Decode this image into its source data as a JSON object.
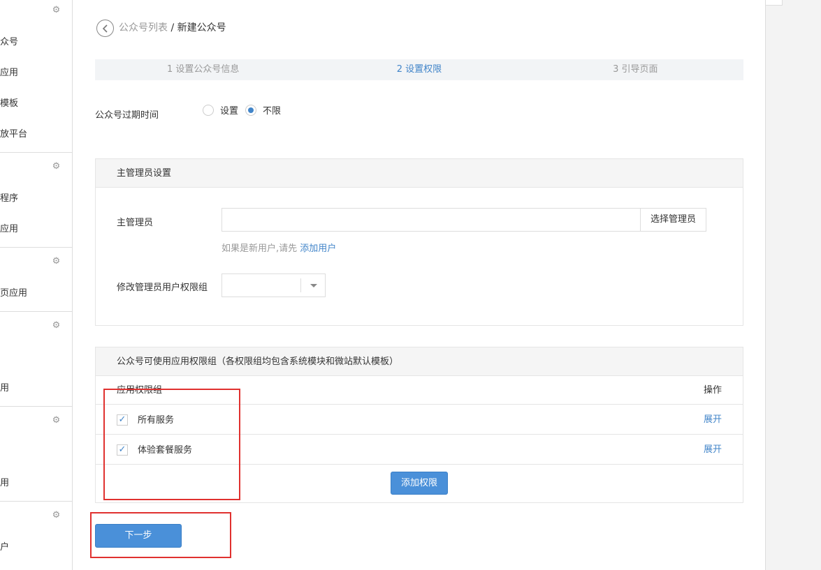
{
  "sidebar": {
    "items": [
      {
        "label": "众号"
      },
      {
        "label": "应用"
      },
      {
        "label": "模板"
      },
      {
        "label": "放平台"
      },
      {
        "label": "程序"
      },
      {
        "label": "应用"
      },
      {
        "label": "页应用"
      },
      {
        "label": "用"
      },
      {
        "label": "用"
      },
      {
        "label": "户"
      }
    ],
    "gear_icon": "gear-icon"
  },
  "breadcrumb": {
    "back_icon": "chevron-left-icon",
    "parent": "公众号列表",
    "separator": "/",
    "current": "新建公众号"
  },
  "steps": [
    {
      "label": "1 设置公众号信息",
      "active": false
    },
    {
      "label": "2 设置权限",
      "active": true
    },
    {
      "label": "3 引导页面",
      "active": false
    }
  ],
  "expiry": {
    "label": "公众号过期时间",
    "options": [
      {
        "label": "设置",
        "selected": false
      },
      {
        "label": "不限",
        "selected": true
      }
    ]
  },
  "admin_panel": {
    "title": "主管理员设置",
    "admin_label": "主管理员",
    "admin_value": "",
    "select_button": "选择管理员",
    "hint_text": "如果是新用户,请先",
    "hint_link": "添加用户",
    "group_label": "修改管理员用户权限组",
    "group_value": ""
  },
  "perm_panel": {
    "title": "公众号可使用应用权限组（各权限组均包含系统模块和微站默认模板）",
    "col_group": "应用权限组",
    "col_action": "操作",
    "rows": [
      {
        "name": "所有服务",
        "checked": true,
        "action": "展开"
      },
      {
        "name": "体验套餐服务",
        "checked": true,
        "action": "展开"
      }
    ],
    "add_button": "添加权限"
  },
  "next_button": "下一步",
  "colors": {
    "accent": "#4285c9",
    "primary_button": "#4a90d9",
    "highlight_box": "#e0312f"
  }
}
